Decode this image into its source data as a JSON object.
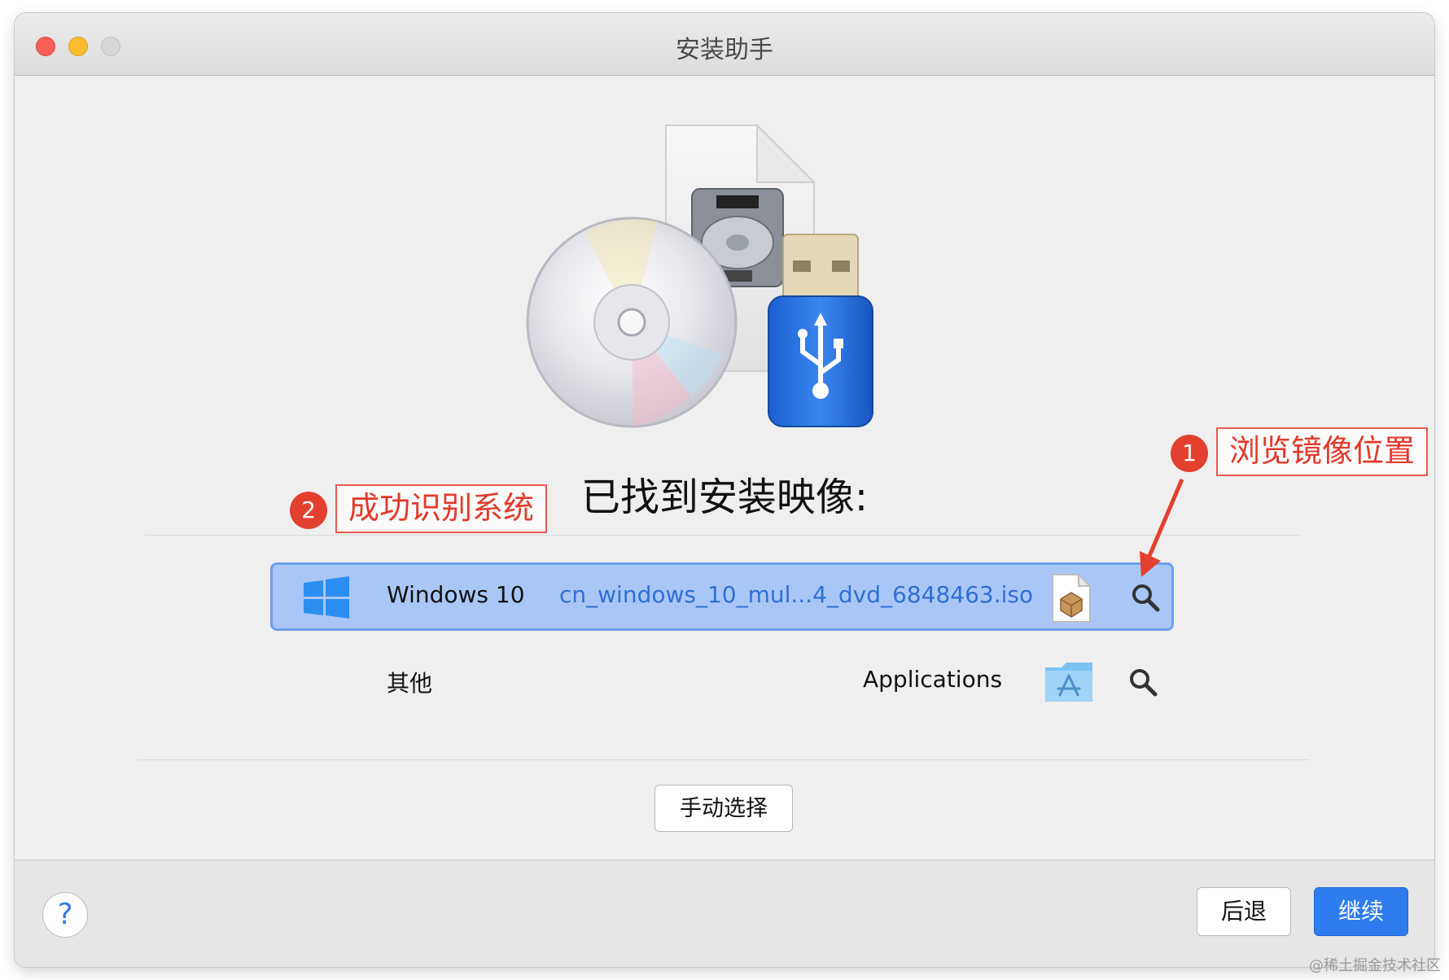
{
  "window": {
    "title": "安装助手"
  },
  "main": {
    "heading": "已找到安装映像:",
    "images": [
      {
        "name": "Windows 10",
        "path": "cn_windows_10_mul...4_dvd_6848463.iso",
        "icon": "iso-file-icon",
        "selected": true
      },
      {
        "name": "其他",
        "path": "Applications",
        "icon": "applications-folder-icon",
        "selected": false
      }
    ],
    "manual_button": "手动选择"
  },
  "footer": {
    "help": "?",
    "back": "后退",
    "continue": "继续"
  },
  "annotations": [
    {
      "number": "1",
      "label": "浏览镜像位置"
    },
    {
      "number": "2",
      "label": "成功识别系统"
    }
  ],
  "watermark": "@稀土掘金技术社区",
  "colors": {
    "accent": "#2f7cf0",
    "selection": "#a9c7f6",
    "annotation": "#e3402f"
  }
}
